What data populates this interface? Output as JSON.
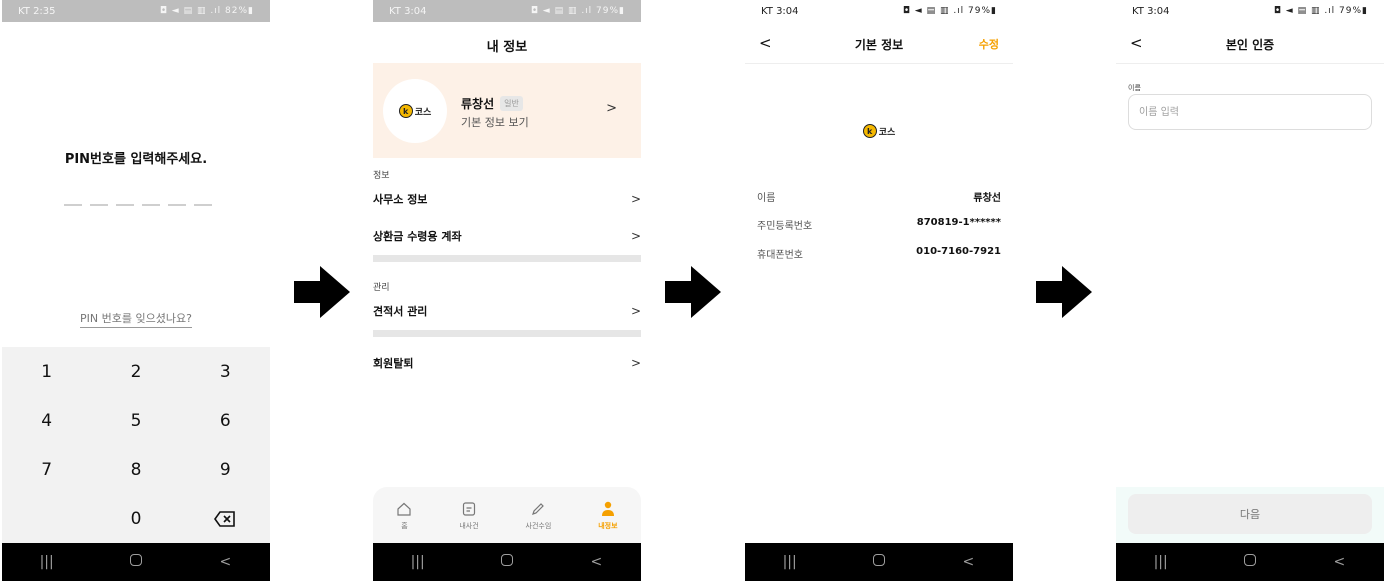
{
  "screen1": {
    "status": {
      "time": "KT 2:35",
      "icons": "◘ ◄ ▤ ▥ .ıl 82%▮"
    },
    "pin_title": "PIN번호를 입력해주세요.",
    "pin_length": 6,
    "forgot_link": "PIN 번호를 잊으셨나요?",
    "keys": [
      "1",
      "2",
      "3",
      "4",
      "5",
      "6",
      "7",
      "8",
      "9",
      "",
      "0",
      "⌫"
    ]
  },
  "screen2": {
    "status": {
      "time": "KT 3:04",
      "icons": "◘ ◄ ▤ ▥ .ıl 79%▮"
    },
    "title": "내 정보",
    "profile": {
      "logo_text": "코스",
      "name": "류창선",
      "badge": "일반",
      "sub": "기본 정보 보기"
    },
    "section_info": "정보",
    "menu_office": "사무소 정보",
    "menu_account": "상환금 수령용 계좌",
    "section_manage": "관리",
    "menu_quote": "견적서 관리",
    "menu_withdraw": "회원탈퇴",
    "tabs": [
      {
        "label": "홈",
        "icon": "home-icon"
      },
      {
        "label": "내사건",
        "icon": "document-icon"
      },
      {
        "label": "사건수임",
        "icon": "pencil-icon"
      },
      {
        "label": "내정보",
        "icon": "person-icon"
      }
    ]
  },
  "screen3": {
    "status": {
      "time": "KT 3:04",
      "icons": "◘ ◄ ▤ ▥ .ıl 79%▮"
    },
    "title": "기본 정보",
    "edit": "수정",
    "logo_text": "코스",
    "rows": [
      {
        "label": "이름",
        "value": "류창선"
      },
      {
        "label": "주민등록번호",
        "value": "870819-1******"
      },
      {
        "label": "휴대폰번호",
        "value": "010-7160-7921"
      }
    ]
  },
  "screen4": {
    "status": {
      "time": "KT 3:04",
      "icons": "◘ ◄ ▤ ▥ .ıl 79%▮"
    },
    "title": "본인 인증",
    "field_label": "이름",
    "field_placeholder": "이름 입력",
    "next": "다음"
  },
  "colors": {
    "accent": "#f5a000",
    "profile_bg": "#fdf1e7",
    "logo_yellow": "#f5b800"
  }
}
